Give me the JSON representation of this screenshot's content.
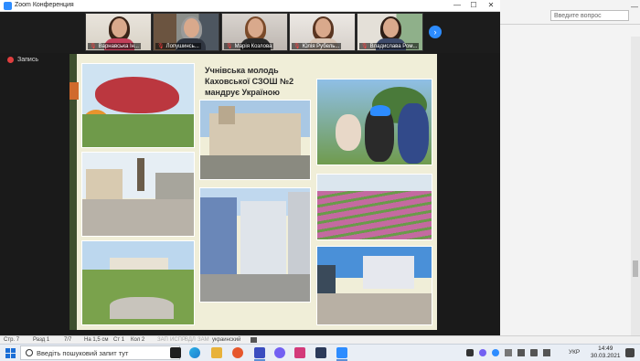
{
  "zoom_window": {
    "title": "Zoom Конференция",
    "controls": {
      "minimize": "—",
      "maximize": "☐",
      "close": "✕"
    },
    "recording_label": "Запись",
    "participants": [
      {
        "name": "Варнавська Ін...",
        "muted": true
      },
      {
        "name": "Лопушинсь...",
        "muted": true
      },
      {
        "name": "Марія Козлова",
        "muted": true
      },
      {
        "name": "Юлія Рубель...",
        "muted": true
      },
      {
        "name": "Владислава Ром...",
        "muted": true
      }
    ],
    "next_page_icon": "chevron-right-icon"
  },
  "slide": {
    "title": "Учнівська молодь Каховської СЗОШ №2 мандрує Україною"
  },
  "word_window": {
    "search_placeholder": "Введите вопрос",
    "min_button": "—"
  },
  "status_bar": {
    "page": "Стр. 7",
    "section": "Разд 1",
    "pages": "7/7",
    "at": "На 1,5 см",
    "line": "Ст 1",
    "col": "Кол 2",
    "zap": "ЗАП",
    "ispr": "ИСПР",
    "vdl": "ВДЛ",
    "zam": "ЗАМ",
    "language": "украинский"
  },
  "taskbar": {
    "search_placeholder": "Введіть пошуковий запит тут",
    "language": "УКР",
    "time": "14:49",
    "date": "30.03.2021"
  }
}
